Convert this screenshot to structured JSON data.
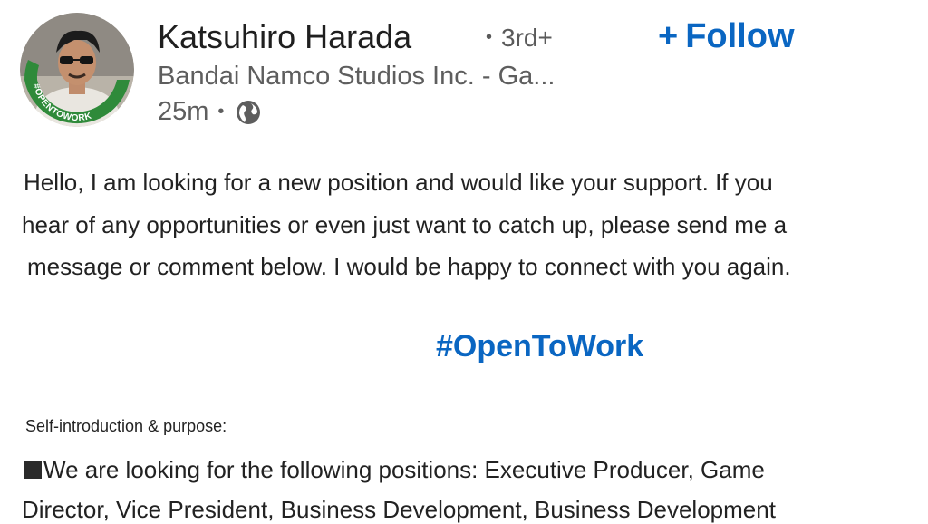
{
  "post": {
    "author": {
      "name": "Katsuhiro Harada",
      "degree": "3rd+",
      "headline": "Bandai Namco Studios Inc. - Ga...",
      "time": "25m",
      "visibility_icon": "globe-icon",
      "avatar_badge": "#OPENTOWORK",
      "avatar_ring_color": "#2f8a3a"
    },
    "follow": {
      "plus": "+",
      "label": "Follow",
      "color": "#0a66c2"
    },
    "body": {
      "line1": "Hello, I am looking for a new position and would like your support. If you",
      "line2": "hear of any opportunities or even just want to catch up, please send me a",
      "line3": "message or comment below. I would be happy to connect with you again.",
      "hashtag": "#OpenToWork",
      "section_label": "Self-introduction & purpose:",
      "line4": "We are looking for the following positions: Executive Producer, Game",
      "line5": "Director, Vice President, Business Development, Business Development"
    }
  }
}
